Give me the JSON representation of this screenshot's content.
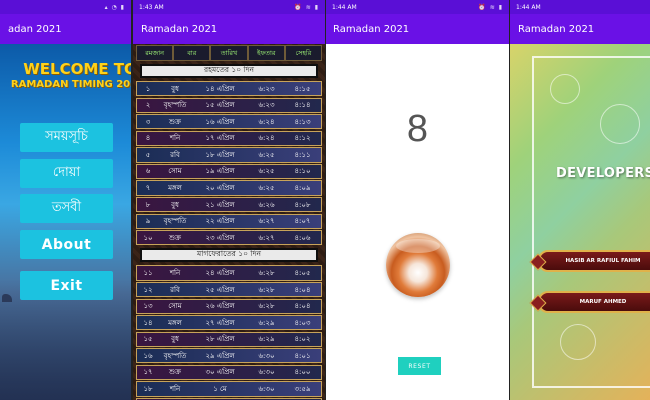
{
  "panel1": {
    "status_time": "",
    "app_title": "adan 2021",
    "welcome_line1": "WELCOME TO",
    "welcome_line2": "RAMADAN TIMING 202",
    "buttons": [
      "সময়সূচি",
      "দোয়া",
      "তসবী",
      "About",
      "Exit"
    ]
  },
  "panel2": {
    "status_time": "1:43 AM",
    "app_title": "Ramadan 2021",
    "headers": [
      "রমজান",
      "বার",
      "তারিখ",
      "ইফতার",
      "সেহরি"
    ],
    "section1": "রহমতের ১০ দিন",
    "section2": "মাগফেরাতের ১০ দিন",
    "rows_first": [
      [
        "১",
        "বুধ",
        "১৪ এপ্রিল",
        "৬:২৩",
        "৪:১৫"
      ],
      [
        "২",
        "বৃহস্পতি",
        "১৫ এপ্রিল",
        "৬:২৩",
        "৪:১৪"
      ],
      [
        "৩",
        "শুক্র",
        "১৬ এপ্রিল",
        "৬:২৪",
        "৪:১৩"
      ],
      [
        "৪",
        "শনি",
        "১৭ এপ্রিল",
        "৬:২৪",
        "৪:১২"
      ],
      [
        "৫",
        "রবি",
        "১৮ এপ্রিল",
        "৬:২৫",
        "৪:১১"
      ],
      [
        "৬",
        "সোম",
        "১৯ এপ্রিল",
        "৬:২৫",
        "৪:১০"
      ],
      [
        "৭",
        "মঙ্গল",
        "২০ এপ্রিল",
        "৬:২৫",
        "৪:০৯"
      ],
      [
        "৮",
        "বুধ",
        "২১ এপ্রিল",
        "৬:২৬",
        "৪:০৮"
      ],
      [
        "৯",
        "বৃহস্পতি",
        "২২ এপ্রিল",
        "৬:২৭",
        "৪:০৭"
      ],
      [
        "১০",
        "শুক্র",
        "২৩ এপ্রিল",
        "৬:২৭",
        "৪:০৬"
      ]
    ],
    "rows_second": [
      [
        "১১",
        "শনি",
        "২৪ এপ্রিল",
        "৬:২৮",
        "৪:০৫"
      ],
      [
        "১২",
        "রবি",
        "২৫ এপ্রিল",
        "৬:২৮",
        "৪:০৪"
      ],
      [
        "১৩",
        "সোম",
        "২৬ এপ্রিল",
        "৬:২৮",
        "৪:০৪"
      ],
      [
        "১৪",
        "মঙ্গল",
        "২৭ এপ্রিল",
        "৬:২৯",
        "৪:০৩"
      ],
      [
        "১৫",
        "বুধ",
        "২৮ এপ্রিল",
        "৬:২৯",
        "৪:০২"
      ],
      [
        "১৬",
        "বৃহস্পতি",
        "২৯ এপ্রিল",
        "৬:৩০",
        "৪:০১"
      ],
      [
        "১৭",
        "শুক্র",
        "৩০ এপ্রিল",
        "৬:৩০",
        "৪:০০"
      ],
      [
        "১৮",
        "শনি",
        "১ মে",
        "৬:৩০",
        "৩:৫৯"
      ],
      [
        "১৯",
        "রবি",
        "২ মে",
        "৬:৩১",
        "৩:৫৮"
      ]
    ]
  },
  "panel3": {
    "status_time": "1:44 AM",
    "app_title": "Ramadan 2021",
    "count": "8",
    "reset_label": "RESET"
  },
  "panel4": {
    "status_time": "1:44 AM",
    "app_title": "Ramadan 2021",
    "heading": "DEVELOPERS",
    "developers": [
      "HASIB AR RAFIUL FAHIM",
      "MARUF AHMED"
    ]
  },
  "colors": {
    "status_bar": "#5a0fd6",
    "app_bar": "#6a11e6",
    "accent_button": "#1cc2e0",
    "reset_button": "#1fd0bf"
  }
}
